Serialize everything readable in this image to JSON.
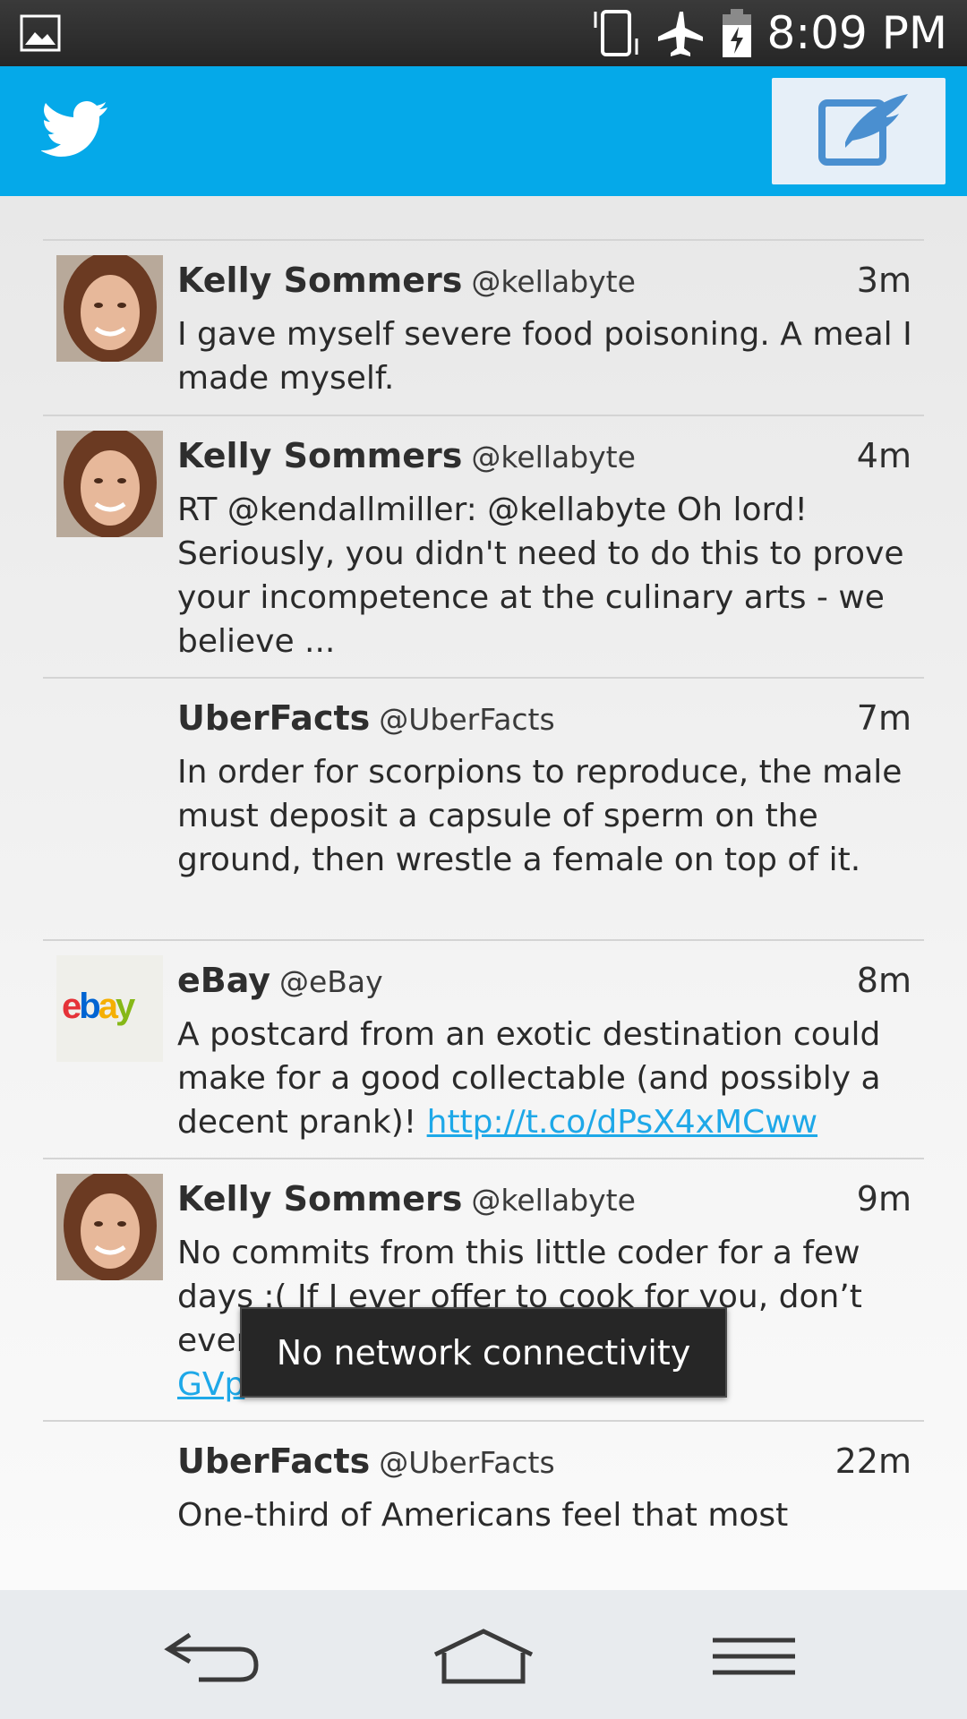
{
  "status_bar": {
    "time": "8:09 PM",
    "icons": [
      "image-notification-icon",
      "vibrate-icon",
      "airplane-mode-icon",
      "battery-charging-icon"
    ]
  },
  "app_bar": {
    "logo_icon": "twitter-bird-icon",
    "compose_icon": "compose-tweet-icon",
    "accent_color": "#05a9e9"
  },
  "tweets": [
    {
      "name": "Kelly Sommers",
      "handle": "@kellabyte",
      "time": "3m",
      "text": "I gave myself severe food poisoning. A meal I made myself.",
      "link": "",
      "avatar": "kelly-avatar"
    },
    {
      "name": "Kelly Sommers",
      "handle": "@kellabyte",
      "time": "4m",
      "text": "RT @kendallmiller: @kellabyte Oh lord! Seriously, you didn't need to do this to prove your incompetence at the culinary arts - we believe ...",
      "link": "",
      "avatar": "kelly-avatar"
    },
    {
      "name": "UberFacts",
      "handle": "@UberFacts",
      "time": "7m",
      "text": "In order for scorpions to reproduce, the male must deposit a capsule of sperm on the ground, then wrestle a female on top of it.",
      "link": "",
      "avatar": ""
    },
    {
      "name": "eBay",
      "handle": "@eBay",
      "time": "8m",
      "text": "A postcard from an exotic destination could make for a good collectable (and possibly a decent prank)! ",
      "link": "http://t.co/dPsX4xMCww",
      "avatar": "ebay-logo"
    },
    {
      "name": "Kelly Sommers",
      "handle": "@kellabyte",
      "time": "9m",
      "text": "No commits from this little coder for a few days :( If I ever offer to cook for you, don’t ever",
      "link": "GVp",
      "avatar": "kelly-avatar"
    },
    {
      "name": "UberFacts",
      "handle": "@UberFacts",
      "time": "22m",
      "text": "One-third of Americans feel that most",
      "link": "",
      "avatar": ""
    }
  ],
  "ebay_logo_letters": [
    "e",
    "b",
    "a",
    "y"
  ],
  "toast": {
    "message": "No network connectivity"
  },
  "nav_bar": {
    "back_icon": "back-icon",
    "home_icon": "home-icon",
    "menu_icon": "menu-icon"
  }
}
